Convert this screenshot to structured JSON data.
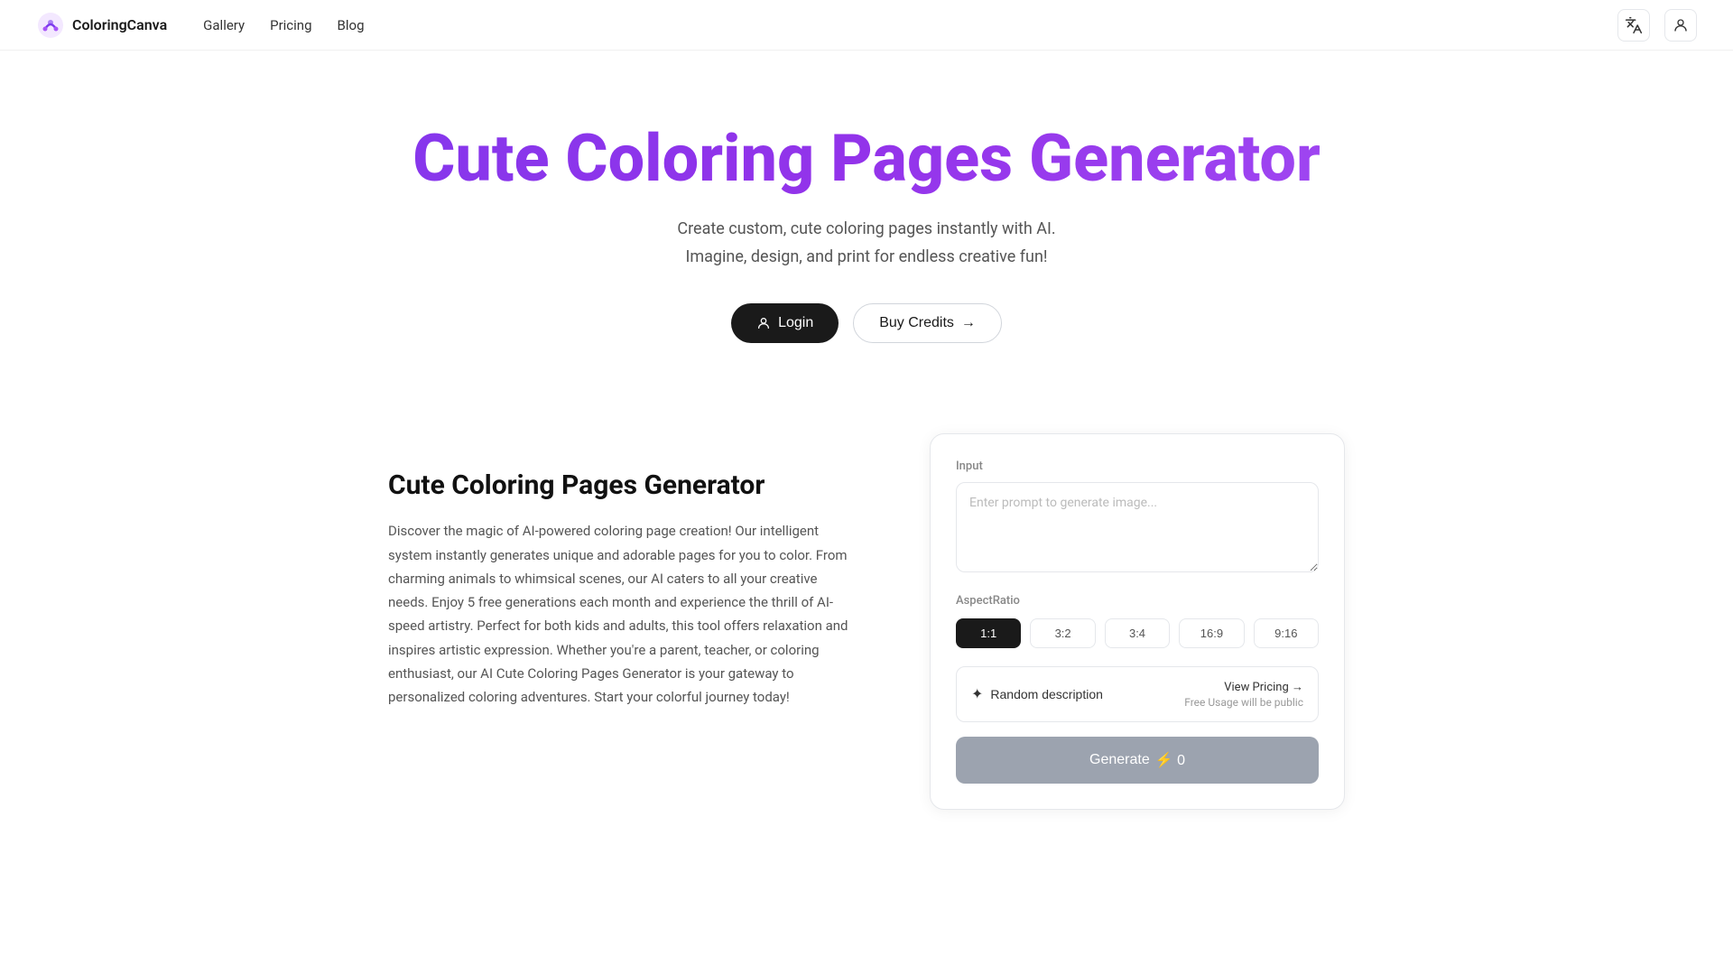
{
  "navbar": {
    "logo_text": "ColoringCanva",
    "nav_items": [
      {
        "label": "Gallery",
        "href": "#"
      },
      {
        "label": "Pricing",
        "href": "#"
      },
      {
        "label": "Blog",
        "href": "#"
      }
    ],
    "translate_icon": "🌐",
    "user_icon": "👤"
  },
  "hero": {
    "title": "Cute Coloring Pages Generator",
    "subtitle_line1": "Create custom, cute coloring pages instantly with AI.",
    "subtitle_line2": "Imagine, design, and print for endless creative fun!",
    "login_button": "Login",
    "buy_credits_button": "Buy Credits",
    "buy_credits_arrow": "→"
  },
  "left_panel": {
    "title": "Cute Coloring Pages Generator",
    "description": "Discover the magic of AI-powered coloring page creation! Our intelligent system instantly generates unique and adorable pages for you to color. From charming animals to whimsical scenes, our AI caters to all your creative needs. Enjoy 5 free generations each month and experience the thrill of AI-speed artistry. Perfect for both kids and adults, this tool offers relaxation and inspires artistic expression. Whether you're a parent, teacher, or coloring enthusiast, our AI Cute Coloring Pages Generator is your gateway to personalized coloring adventures. Start your colorful journey today!"
  },
  "right_card": {
    "input_label": "Input",
    "prompt_placeholder": "Enter prompt to generate image...",
    "aspect_ratio_label": "AspectRatio",
    "aspect_options": [
      {
        "label": "1:1",
        "active": true
      },
      {
        "label": "3:2",
        "active": false
      },
      {
        "label": "3:4",
        "active": false
      },
      {
        "label": "16:9",
        "active": false
      },
      {
        "label": "9:16",
        "active": false
      }
    ],
    "random_description_label": "Random description",
    "view_pricing_label": "View Pricing →",
    "free_usage_label": "Free Usage will be public",
    "generate_button": "Generate",
    "generate_cost": "⚡ 0"
  }
}
